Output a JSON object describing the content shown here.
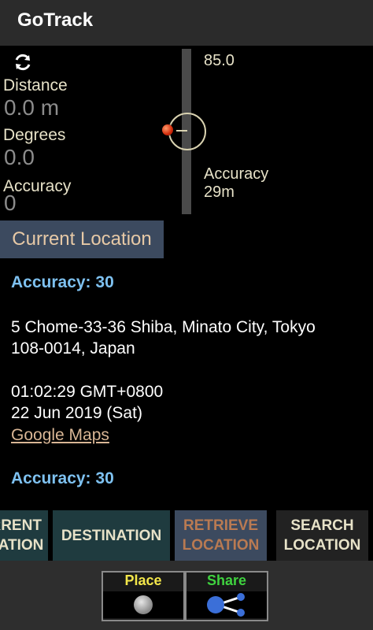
{
  "app": {
    "title": "GoTrack"
  },
  "panel": {
    "distance_label": "Distance",
    "distance_value": "0.0 m",
    "degrees_label": "Degrees",
    "degrees_value": "0.0",
    "accuracy_label": "Accuracy",
    "accuracy_value": "0",
    "bearing_value": "85.0",
    "side_accuracy_label": "Accuracy",
    "side_accuracy_value": "29m"
  },
  "current_location_tab": "Current Location",
  "info": {
    "accuracy_1": "Accuracy: 30",
    "address_line1": "5 Chome-33-36 Shiba, Minato City, Tokyo",
    "address_line2": "108-0014, Japan",
    "time": "01:02:29 GMT+0800",
    "date": "22 Jun 2019 (Sat)",
    "maps_link": "Google Maps",
    "accuracy_2": "Accuracy: 30"
  },
  "tabs": [
    {
      "line1": "CURRENT",
      "line2": "LOCATION"
    },
    {
      "line1": "DESTINATION",
      "line2": ""
    },
    {
      "line1": "RETRIEVE",
      "line2": "LOCATION"
    },
    {
      "line1": "SEARCH",
      "line2": "LOCATION"
    }
  ],
  "bottom": {
    "place_label": "Place",
    "share_label": "Share",
    "place_color": "#f2e64a",
    "share_color": "#3fd23f"
  },
  "icons": {
    "refresh": "refresh-icon",
    "place": "place-icon",
    "share": "share-icon"
  }
}
